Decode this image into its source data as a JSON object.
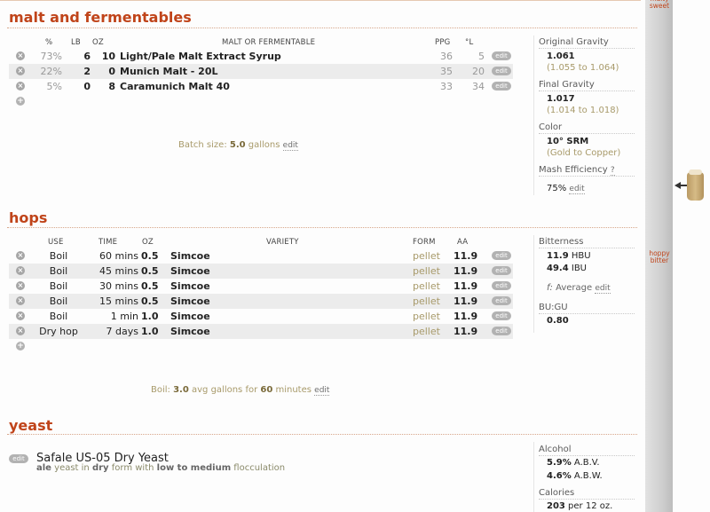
{
  "malt": {
    "title": "malt and fermentables",
    "headers": {
      "pct": "%",
      "lb": "LB",
      "oz": "OZ",
      "name": "MALT OR FERMENTABLE",
      "ppg": "PPG",
      "lovibond": "°L"
    },
    "rows": [
      {
        "pct": "73%",
        "lb": "6",
        "oz": "10",
        "name": "Light/Pale Malt Extract Syrup",
        "ppg": "36",
        "lovibond": "5",
        "edit": "edit"
      },
      {
        "pct": "22%",
        "lb": "2",
        "oz": "0",
        "name": "Munich Malt - 20L",
        "ppg": "35",
        "lovibond": "20",
        "edit": "edit"
      },
      {
        "pct": "5%",
        "lb": "0",
        "oz": "8",
        "name": "Caramunich Malt 40",
        "ppg": "33",
        "lovibond": "34",
        "edit": "edit"
      }
    ],
    "batch": {
      "prefix": "Batch size: ",
      "value": "5.0",
      "unit": " gallons",
      "edit": "edit"
    }
  },
  "gravity": {
    "og_label": "Original Gravity",
    "og_value": "1.061",
    "og_range": "(1.055 to 1.064)",
    "fg_label": "Final Gravity",
    "fg_value": "1.017",
    "fg_range": "(1.014 to 1.018)",
    "color_label": "Color",
    "color_value": "10° SRM",
    "color_range": "(Gold to Copper)",
    "mash_label": "Mash Efficiency",
    "mash_help": "?",
    "mash_value": "75%",
    "mash_edit": "edit"
  },
  "hops": {
    "title": "hops",
    "headers": {
      "use": "USE",
      "time": "TIME",
      "oz": "OZ",
      "variety": "VARIETY",
      "form": "FORM",
      "aa": "AA"
    },
    "rows": [
      {
        "use": "Boil",
        "time": "60 mins",
        "oz": "0.5",
        "variety": "Simcoe",
        "form": "pellet",
        "aa": "11.9",
        "edit": "edit"
      },
      {
        "use": "Boil",
        "time": "45 mins",
        "oz": "0.5",
        "variety": "Simcoe",
        "form": "pellet",
        "aa": "11.9",
        "edit": "edit"
      },
      {
        "use": "Boil",
        "time": "30 mins",
        "oz": "0.5",
        "variety": "Simcoe",
        "form": "pellet",
        "aa": "11.9",
        "edit": "edit"
      },
      {
        "use": "Boil",
        "time": "15 mins",
        "oz": "0.5",
        "variety": "Simcoe",
        "form": "pellet",
        "aa": "11.9",
        "edit": "edit"
      },
      {
        "use": "Boil",
        "time": "1 min",
        "oz": "1.0",
        "variety": "Simcoe",
        "form": "pellet",
        "aa": "11.9",
        "edit": "edit"
      },
      {
        "use": "Dry hop",
        "time": "7 days",
        "oz": "1.0",
        "variety": "Simcoe",
        "form": "pellet",
        "aa": "11.9",
        "edit": "edit"
      }
    ],
    "boil": {
      "prefix": "Boil: ",
      "value": "3.0",
      "mid": " avg gallons for ",
      "minutes": "60",
      "suffix": " minutes",
      "edit": "edit"
    }
  },
  "bitterness": {
    "label": "Bitterness",
    "hbu_value": "11.9",
    "hbu_unit": " HBU",
    "ibu_value": "49.4",
    "ibu_unit": " IBU",
    "formula_glyph": "f:",
    "formula": " Average",
    "formula_edit": "edit",
    "bugu_label": "BU:GU",
    "bugu_value": "0.80"
  },
  "yeast": {
    "title": "yeast",
    "edit": "edit",
    "name": "Safale US-05 Dry Yeast",
    "type": "ale",
    "t1": " yeast in ",
    "form": "dry",
    "t2": " form with ",
    "floc": "low to medium",
    "t3": " flocculation"
  },
  "alcohol": {
    "label": "Alcohol",
    "abv_value": "5.9%",
    "abv_unit": " A.B.V.",
    "abw_value": "4.6%",
    "abw_unit": " A.B.W."
  },
  "calories": {
    "label": "Calories",
    "value": "203",
    "unit": " per 12 oz."
  },
  "scale": {
    "top_label": "malty sweet",
    "bottom_label": "hoppy bitter"
  },
  "icons": {
    "remove": "remove-x-icon",
    "add": "add-plus-icon",
    "marker": "arrow-left-icon",
    "beer": "beer-glass-icon"
  },
  "colors": {
    "accent": "#c0441a",
    "muted_olive": "#a89a6a"
  }
}
